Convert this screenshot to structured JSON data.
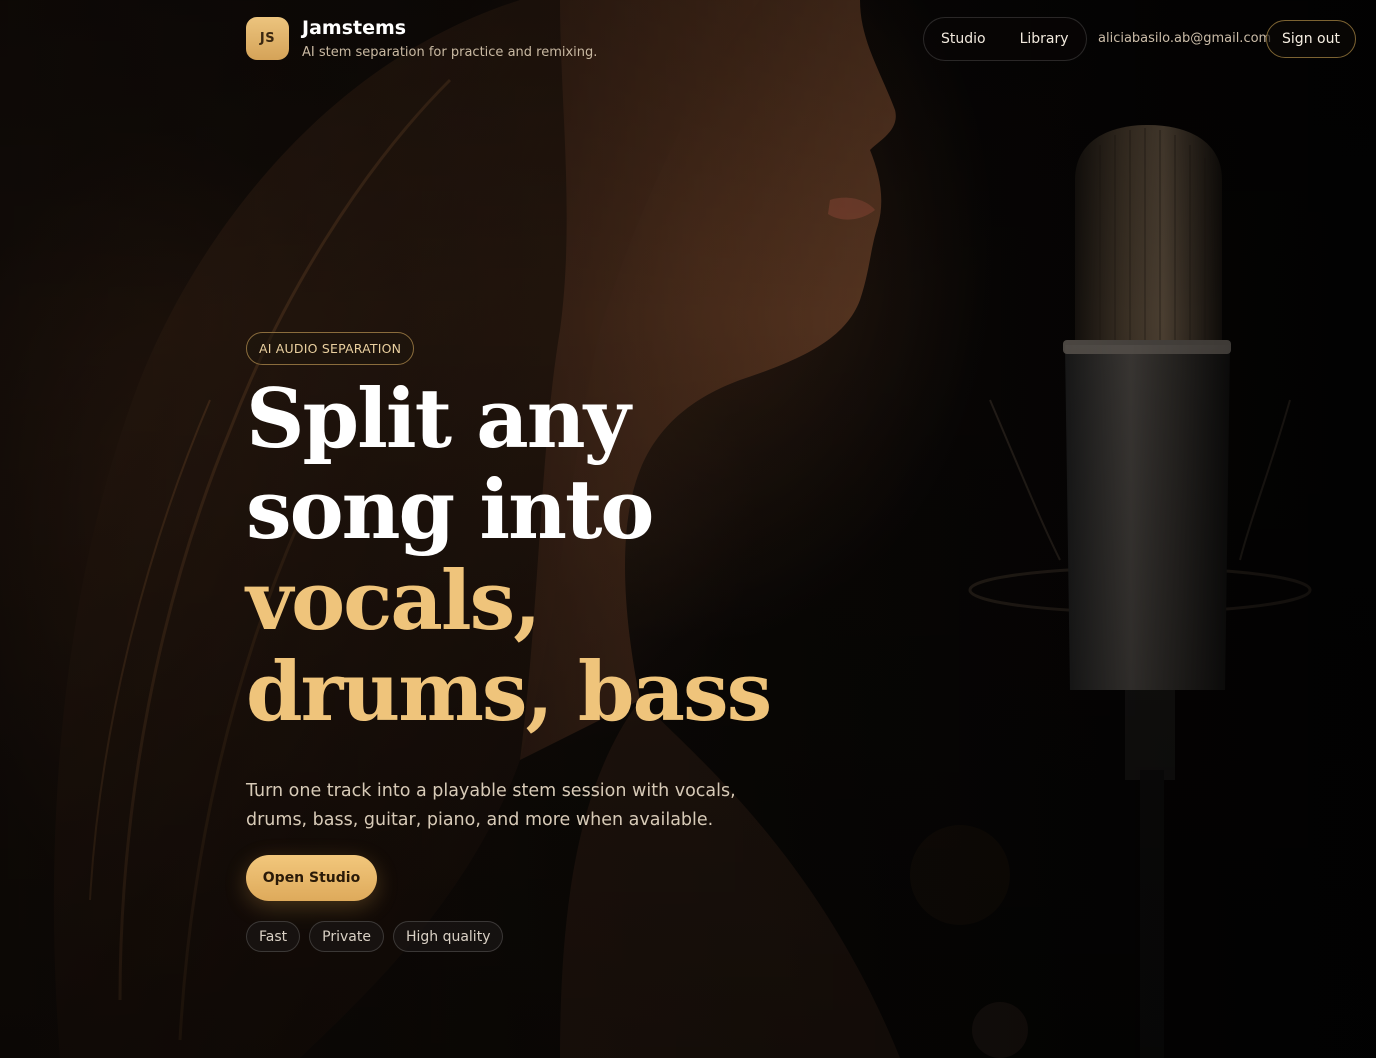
{
  "brand": {
    "logo_initials": "JS",
    "name": "Jamstems",
    "tagline": "AI stem separation for practice and remixing."
  },
  "nav": {
    "items": [
      {
        "label": "Studio"
      },
      {
        "label": "Library"
      }
    ],
    "user_email": "aliciabasilo.ab@gmail.com",
    "sign_out_label": "Sign out"
  },
  "hero": {
    "eyebrow": "AI AUDIO SEPARATION",
    "headline_lines": [
      {
        "text": "Split any",
        "accent": false
      },
      {
        "text": "song into",
        "accent": false
      },
      {
        "text": "vocals,",
        "accent": true
      },
      {
        "text": "drums, bass",
        "accent": true
      }
    ],
    "subcopy": "Turn one track into a playable stem session with vocals, drums, bass, guitar, piano, and more when available.",
    "cta_label": "Open Studio",
    "feature_tags": [
      "Fast",
      "Private",
      "High quality"
    ]
  },
  "colors": {
    "accent_gold": "#efc47b",
    "background": "#050403",
    "text_primary": "#ffffff"
  },
  "background_image": "woman singing into a studio condenser microphone in dark amber light"
}
